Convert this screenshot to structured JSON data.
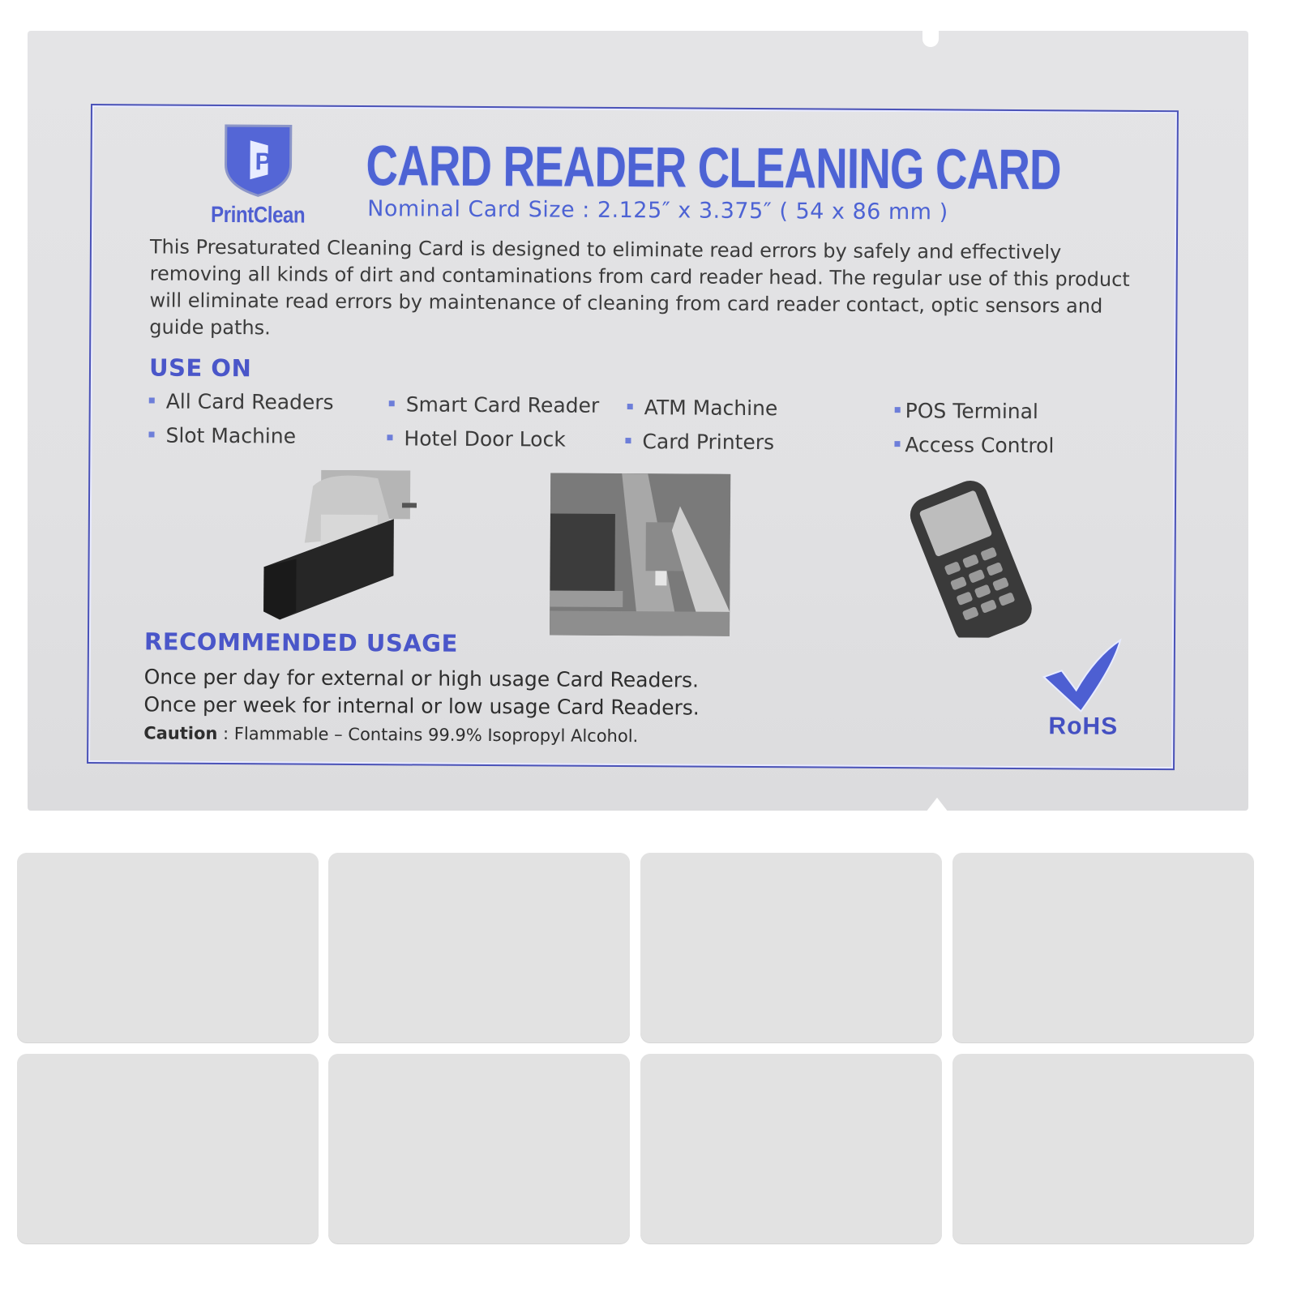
{
  "product": {
    "brand": "PrintClean",
    "title": "CARD READER CLEANING CARD",
    "subtitle": "Nominal Card Size : 2.125″ x 3.375″ ( 54 x 86 mm )",
    "description": "This Presaturated Cleaning Card is designed to eliminate read errors by safely and effectively removing all kinds of dirt and contaminations from card reader head. The regular use of this product will eliminate read errors by maintenance of cleaning from card reader contact, optic sensors and guide paths.",
    "use_on": {
      "heading": "USE ON",
      "items": [
        "All Card Readers",
        "Smart Card Reader",
        "ATM Machine",
        "POS Terminal",
        "Slot Machine",
        "Hotel Door Lock",
        "Card Printers",
        "Access Control"
      ]
    },
    "images": [
      {
        "name": "magnetic-card-reader-photo"
      },
      {
        "name": "atm-machine-photo"
      },
      {
        "name": "pos-terminal-photo"
      }
    ],
    "recommended_usage": {
      "heading": "RECOMMENDED USAGE",
      "lines": [
        "Once per day for external or high usage Card Readers.",
        "Once per week for internal or low usage Card Readers."
      ],
      "caution_label": "Caution",
      "caution_text": " : Flammable – Contains 99.9% Isopropyl Alcohol."
    },
    "certification": "RoHS",
    "logo_letter": "P"
  },
  "blank_cards": {
    "count": 8
  },
  "colors": {
    "brand_blue": "#4d63d4",
    "border_blue": "#4a52b8",
    "body_text": "#3b3b3b",
    "pouch": "#e2e2e4",
    "card": "#e2e2e2"
  }
}
